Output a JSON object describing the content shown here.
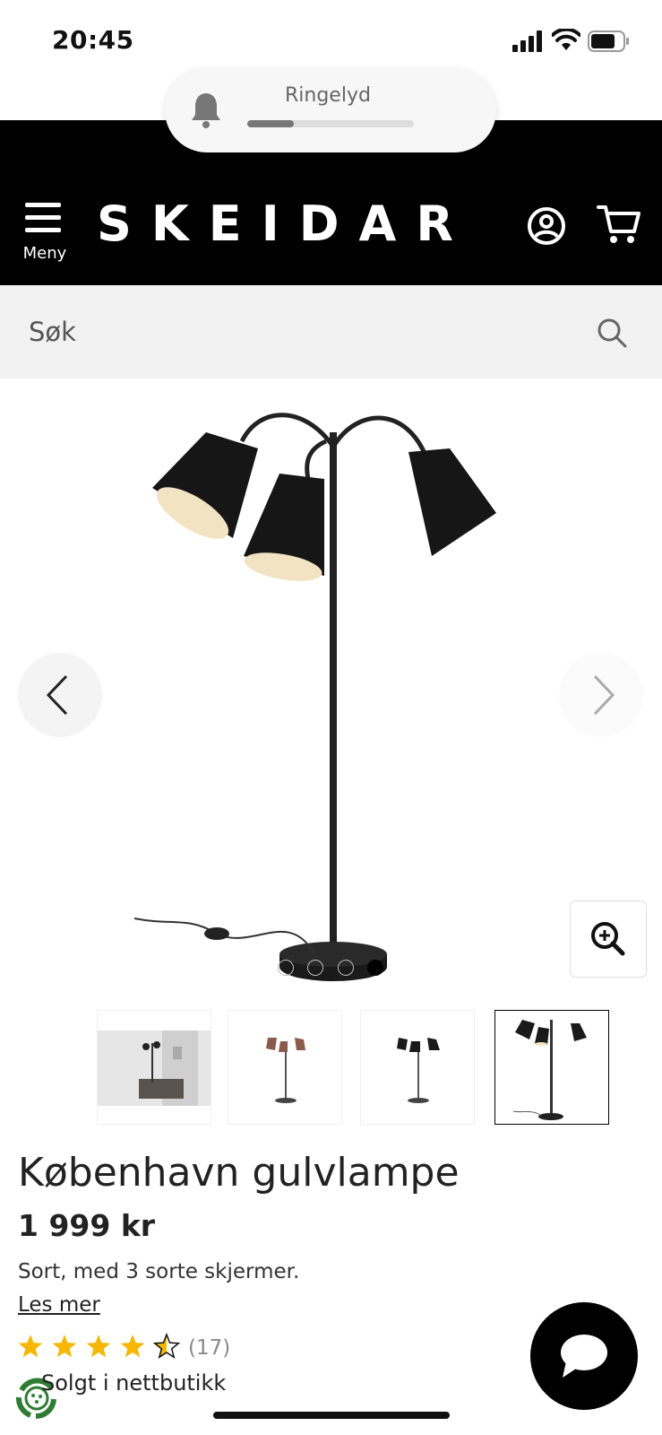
{
  "status": {
    "time": "20:45"
  },
  "ringer": {
    "label": "Ringelyd",
    "level": 0.28
  },
  "header": {
    "menu_label": "Meny",
    "logo": "SKEIDAR"
  },
  "search": {
    "placeholder": "Søk"
  },
  "gallery": {
    "image_count": 4,
    "active_index": 3
  },
  "product": {
    "title": "København gulvlampe",
    "price": "1 999 kr",
    "description": "Sort, med 3 sorte skjermer.",
    "read_more": "Les mer",
    "rating": 4.5,
    "review_count": "(17)",
    "sold_text": "Solgt i nettbutikk"
  },
  "colors": {
    "header_bg": "#000000",
    "star": "#f5b700",
    "lamp_shade": "#1a1a1a",
    "lamp_inner": "#f2e3c2"
  },
  "icons": [
    "bell-icon",
    "hamburger-icon",
    "account-icon",
    "cart-icon",
    "search-icon",
    "chevron-left-icon",
    "chevron-right-icon",
    "zoom-in-icon",
    "star-icon",
    "chat-icon",
    "recycle-icon"
  ]
}
